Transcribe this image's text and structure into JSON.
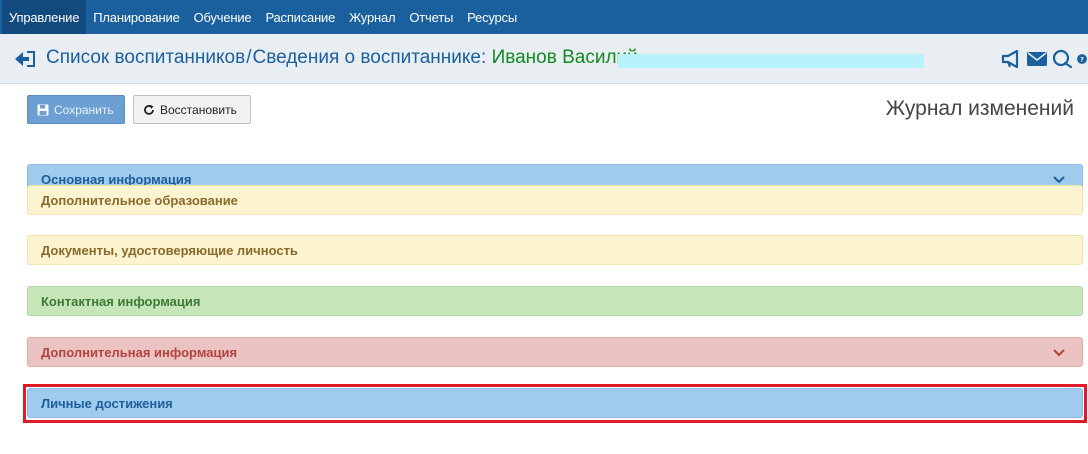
{
  "nav": {
    "items": [
      "Управление",
      "Планирование",
      "Обучение",
      "Расписание",
      "Журнал",
      "Отчеты",
      "Ресурсы"
    ],
    "active": "Управление"
  },
  "breadcrumb": {
    "parent": "Список воспитанников",
    "separator": "/",
    "current": "Сведения о воспитаннике:",
    "person": "Иванов Василий"
  },
  "toolbar": {
    "save_label": "Сохранить",
    "restore_label": "Восстановить",
    "changelog_label": "Журнал изменений"
  },
  "sections": [
    {
      "label": "Основная информация",
      "color": "blue",
      "chevron": true
    },
    {
      "label": "Дополнительное образование",
      "color": "yellow",
      "chevron": false
    },
    {
      "label": "Документы, удостоверяющие личность",
      "color": "yellow",
      "chevron": false
    },
    {
      "label": "Контактная информация",
      "color": "green",
      "chevron": false
    },
    {
      "label": "Дополнительная информация",
      "color": "red",
      "chevron": true
    },
    {
      "label": "Личные достижения",
      "color": "blue",
      "chevron": false,
      "highlighted": true
    }
  ],
  "colors": {
    "nav_bg": "#1a5f9e",
    "accent_green": "#128a20",
    "highlight_border": "#e01a27"
  },
  "icons": [
    "back-arrow-icon",
    "megaphone-icon",
    "envelope-icon",
    "chat-icon",
    "help-icon",
    "save-icon",
    "refresh-icon",
    "chevron-down-icon"
  ]
}
